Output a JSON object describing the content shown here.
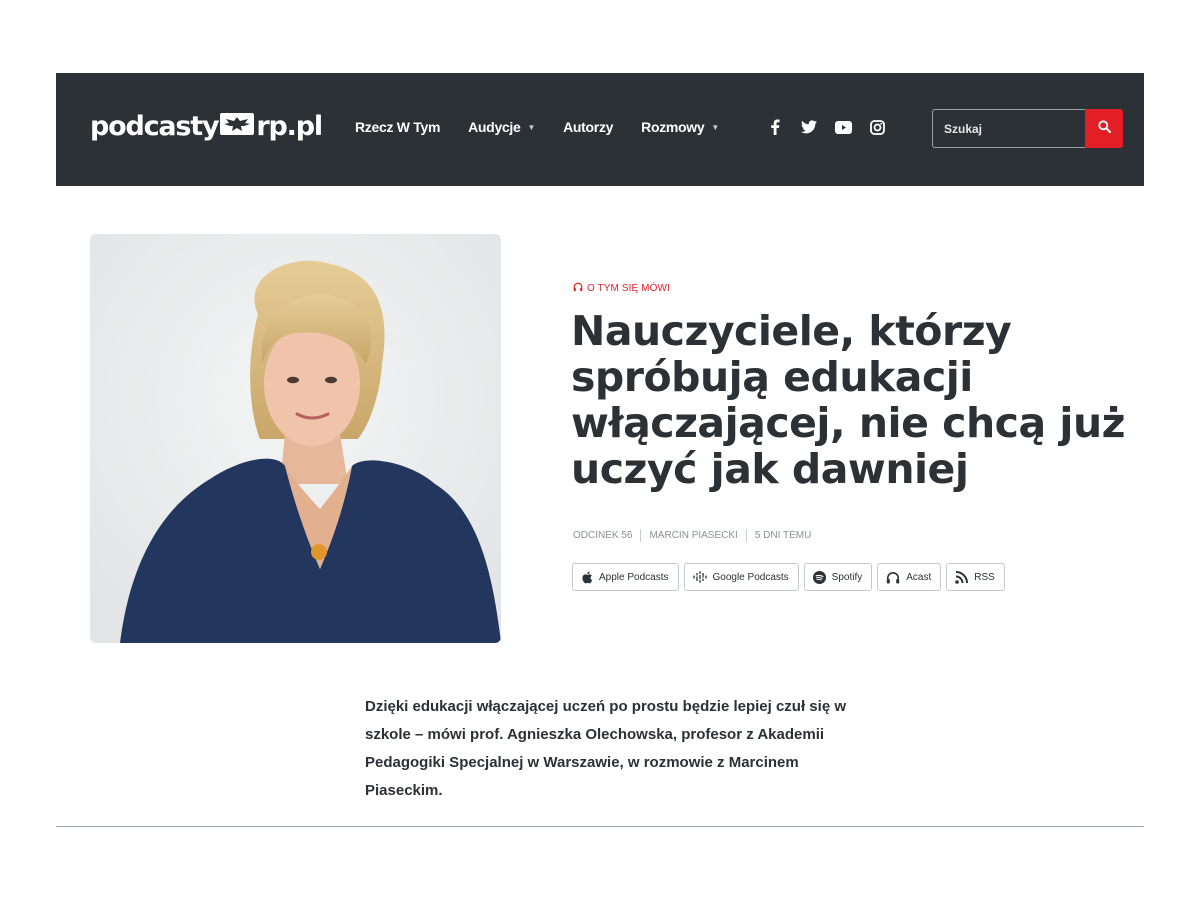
{
  "site": {
    "logo_left": "podcasty",
    "logo_right": "rp.pl"
  },
  "nav": {
    "items": [
      {
        "label": "Rzecz W Tym",
        "has_dropdown": false
      },
      {
        "label": "Audycje",
        "has_dropdown": true
      },
      {
        "label": "Autorzy",
        "has_dropdown": false
      },
      {
        "label": "Rozmowy",
        "has_dropdown": true
      }
    ],
    "dropdown_icon": "caret-down-icon"
  },
  "socials": [
    "facebook-icon",
    "twitter-icon",
    "youtube-icon",
    "instagram-icon"
  ],
  "search": {
    "placeholder": "Szukaj",
    "button_icon": "search-icon"
  },
  "article": {
    "category": "O TYM SIĘ MÓWI",
    "title": "Nauczyciele, którzy spróbują edukacji włączającej, nie chcą już uczyć jak dawniej",
    "meta": {
      "episode": "ODCINEK 56",
      "author": "MARCIN PIASECKI",
      "time": "5 DNI TEMU"
    },
    "platforms": [
      {
        "label": "Apple Podcasts",
        "icon": "apple-icon"
      },
      {
        "label": "Google Podcasts",
        "icon": "google-podcasts-icon"
      },
      {
        "label": "Spotify",
        "icon": "spotify-icon"
      },
      {
        "label": "Acast",
        "icon": "headphones-icon"
      },
      {
        "label": "RSS",
        "icon": "rss-icon"
      }
    ],
    "lead": "Dzięki edukacji włączającej uczeń po prostu będzie lepiej czuł się w szkole – mówi prof. Agnieszka Olechowska, profesor z Akademii Pedagogiki Specjalnej w Warszawie, w rozmowie z Marcinem Piaseckim."
  },
  "colors": {
    "header_bg": "#2c3136",
    "accent": "#e21f26",
    "text": "#2c3136",
    "muted": "#8a9096"
  }
}
